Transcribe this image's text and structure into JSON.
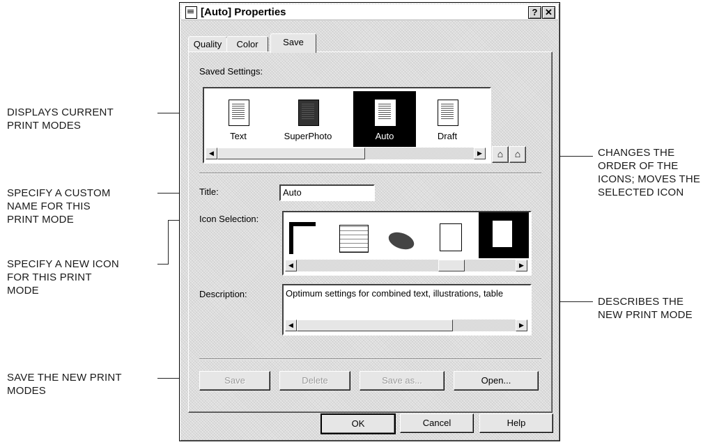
{
  "window": {
    "title": "[Auto] Properties",
    "help_btn": "?",
    "close_btn": "✕"
  },
  "tabs": [
    {
      "label": "Quality"
    },
    {
      "label": "Color"
    },
    {
      "label": "Save",
      "active": true
    }
  ],
  "saved_settings": {
    "label": "Saved Settings:",
    "items": [
      {
        "label": "Text"
      },
      {
        "label": "SuperPhoto"
      },
      {
        "label": "Auto",
        "selected": true
      },
      {
        "label": "Draft"
      }
    ]
  },
  "title_field": {
    "label": "Title:",
    "value": "Auto"
  },
  "icon_selection": {
    "label": "Icon Selection:"
  },
  "description": {
    "label": "Description:",
    "value": "Optimum settings for combined text, illustrations, table"
  },
  "action_buttons": {
    "save": "Save",
    "delete": "Delete",
    "save_as": "Save as...",
    "open": "Open..."
  },
  "footer_buttons": {
    "ok": "OK",
    "cancel": "Cancel",
    "help": "Help"
  },
  "callouts": {
    "displays": "DISPLAYS CURRENT\nPRINT MODES",
    "specify_name": "SPECIFY A CUSTOM\nNAME FOR THIS\nPRINT MODE",
    "specify_icon": "SPECIFY A NEW ICON\nFOR THIS PRINT\nMODE",
    "save_new": "SAVE THE NEW PRINT\nMODES",
    "changes_order": "CHANGES THE\nORDER OF THE\nICONS; MOVES THE\nSELECTED ICON",
    "describes": "DESCRIBES THE\nNEW PRINT MODE"
  }
}
